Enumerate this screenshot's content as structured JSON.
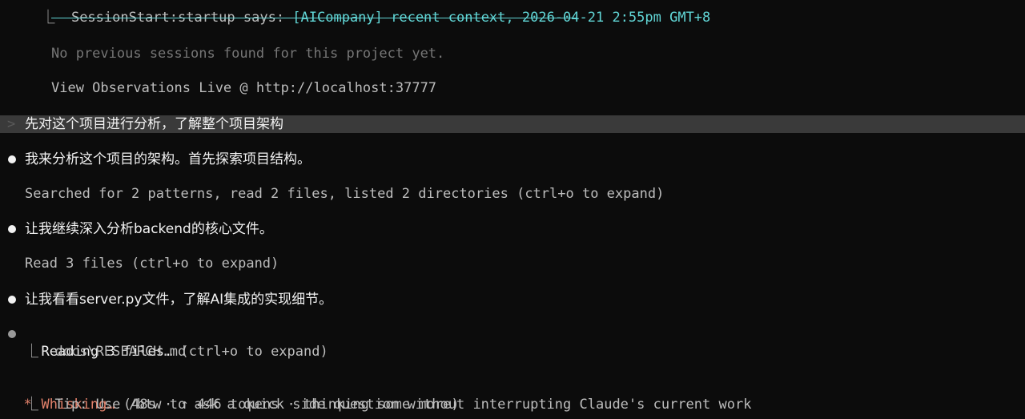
{
  "header": {
    "hook_prefix": "⎿  SessionStart:startup says: ",
    "hook_context": "[AICompany] recent context, 2026-04-21 2:55pm GMT+8"
  },
  "hook_output": {
    "no_sessions": "No previous sessions found for this project yet.",
    "view_live": "View Observations Live @ http://localhost:37777"
  },
  "prompt": {
    "glyph": ">",
    "text": "先对这个项目进行分析，了解整个项目架构"
  },
  "transcript": [
    {
      "text": "我来分析这个项目的架构。首先探索项目结构。"
    },
    {
      "detail": "Searched for 2 patterns, read 2 files, listed 2 directories (ctrl+o to expand)"
    },
    {
      "text": "让我继续深入分析backend的核心文件。"
    },
    {
      "detail": "Read 3 files (ctrl+o to expand)"
    },
    {
      "text": "让我看看server.py文件，了解AI集成的实现细节。"
    }
  ],
  "active_tool": {
    "label": "Reading 3 files…",
    "hint": " (ctrl+o to expand)",
    "subitem": "⎿  docs\\RESEARCH.md"
  },
  "status": {
    "spinner": "*",
    "verb": "Whisking…",
    "meta": " (48s · ↑ 446 tokens · thinking some more)",
    "tip": "⎿  Tip: Use /btw to ask a quick side question without interrupting Claude's current work"
  },
  "colors": {
    "background": "#0c0c0c",
    "accent_cyan": "#61d6d6",
    "spinner_orange": "#e0806a",
    "prompt_highlight": "#3a3a3a"
  }
}
